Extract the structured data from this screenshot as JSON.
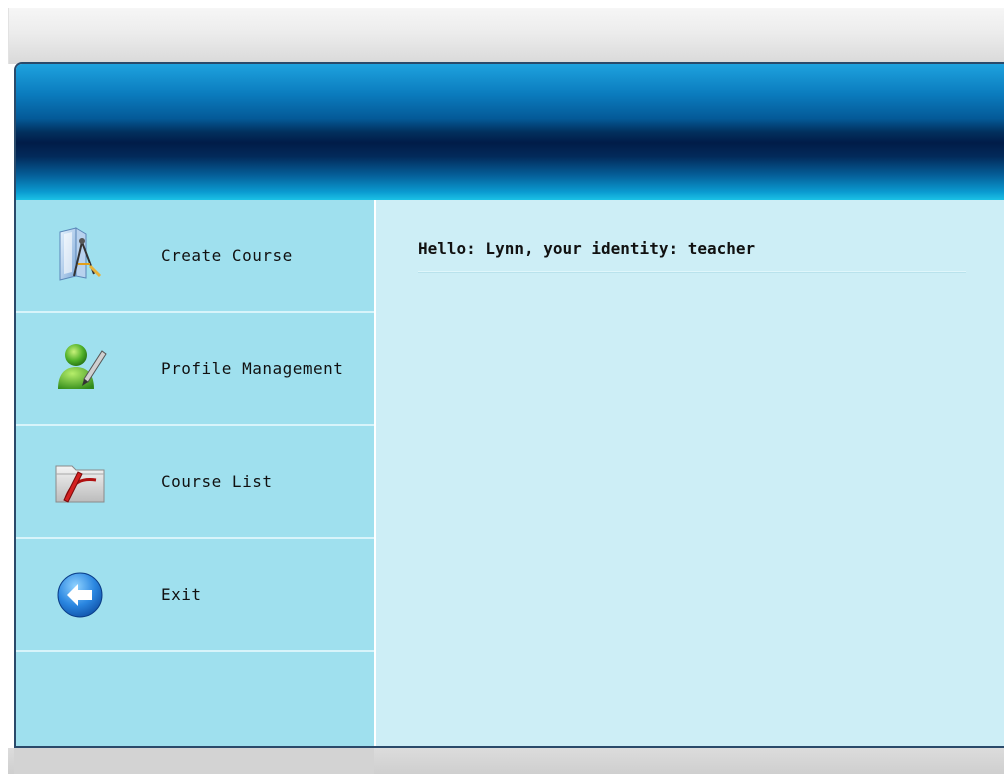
{
  "header": {
    "banner_name": "header-banner"
  },
  "sidebar": {
    "items": [
      {
        "label": "Create Course",
        "icon": "create-course-icon"
      },
      {
        "label": "Profile Management",
        "icon": "profile-management-icon"
      },
      {
        "label": "Course List",
        "icon": "course-list-icon"
      },
      {
        "label": "Exit",
        "icon": "exit-arrow-icon"
      }
    ]
  },
  "main": {
    "greeting": "Hello: Lynn, your identity: teacher"
  },
  "colors": {
    "sidebar_bg": "#9fe0ee",
    "content_bg": "#cdeef6",
    "header_dark": "#011c48",
    "header_light": "#1ea2de"
  }
}
